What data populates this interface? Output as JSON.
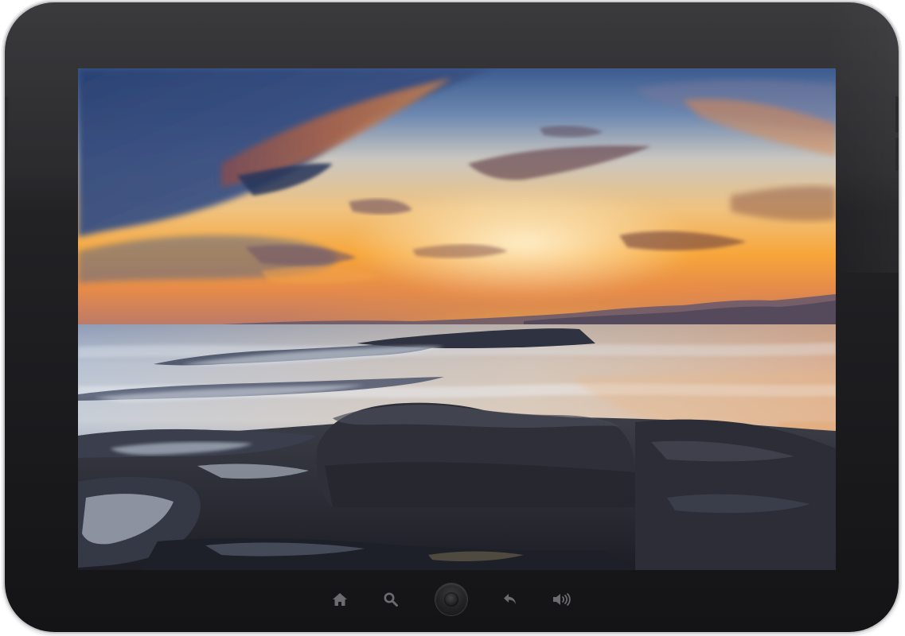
{
  "device": {
    "type": "tablet",
    "frame_color": "#1e1e21",
    "bezel_highlight": "#e9e9ea"
  },
  "screen": {
    "content": "sunset-seascape-wallpaper",
    "palette": {
      "sky_top": "#3d5a8e",
      "sky_mid": "#e9c28a",
      "sun_glow": "#ffb21e",
      "horizon": "#b9784f",
      "sea": "#a9b6c8",
      "rocks": "#2b2c33"
    }
  },
  "navbar": {
    "buttons": [
      {
        "name": "home",
        "icon": "home-icon"
      },
      {
        "name": "search",
        "icon": "search-icon"
      },
      {
        "name": "center",
        "icon": "home-button-icon"
      },
      {
        "name": "back",
        "icon": "back-arrow-icon"
      },
      {
        "name": "volume",
        "icon": "volume-icon"
      }
    ],
    "icon_color": "#6b6b70"
  }
}
